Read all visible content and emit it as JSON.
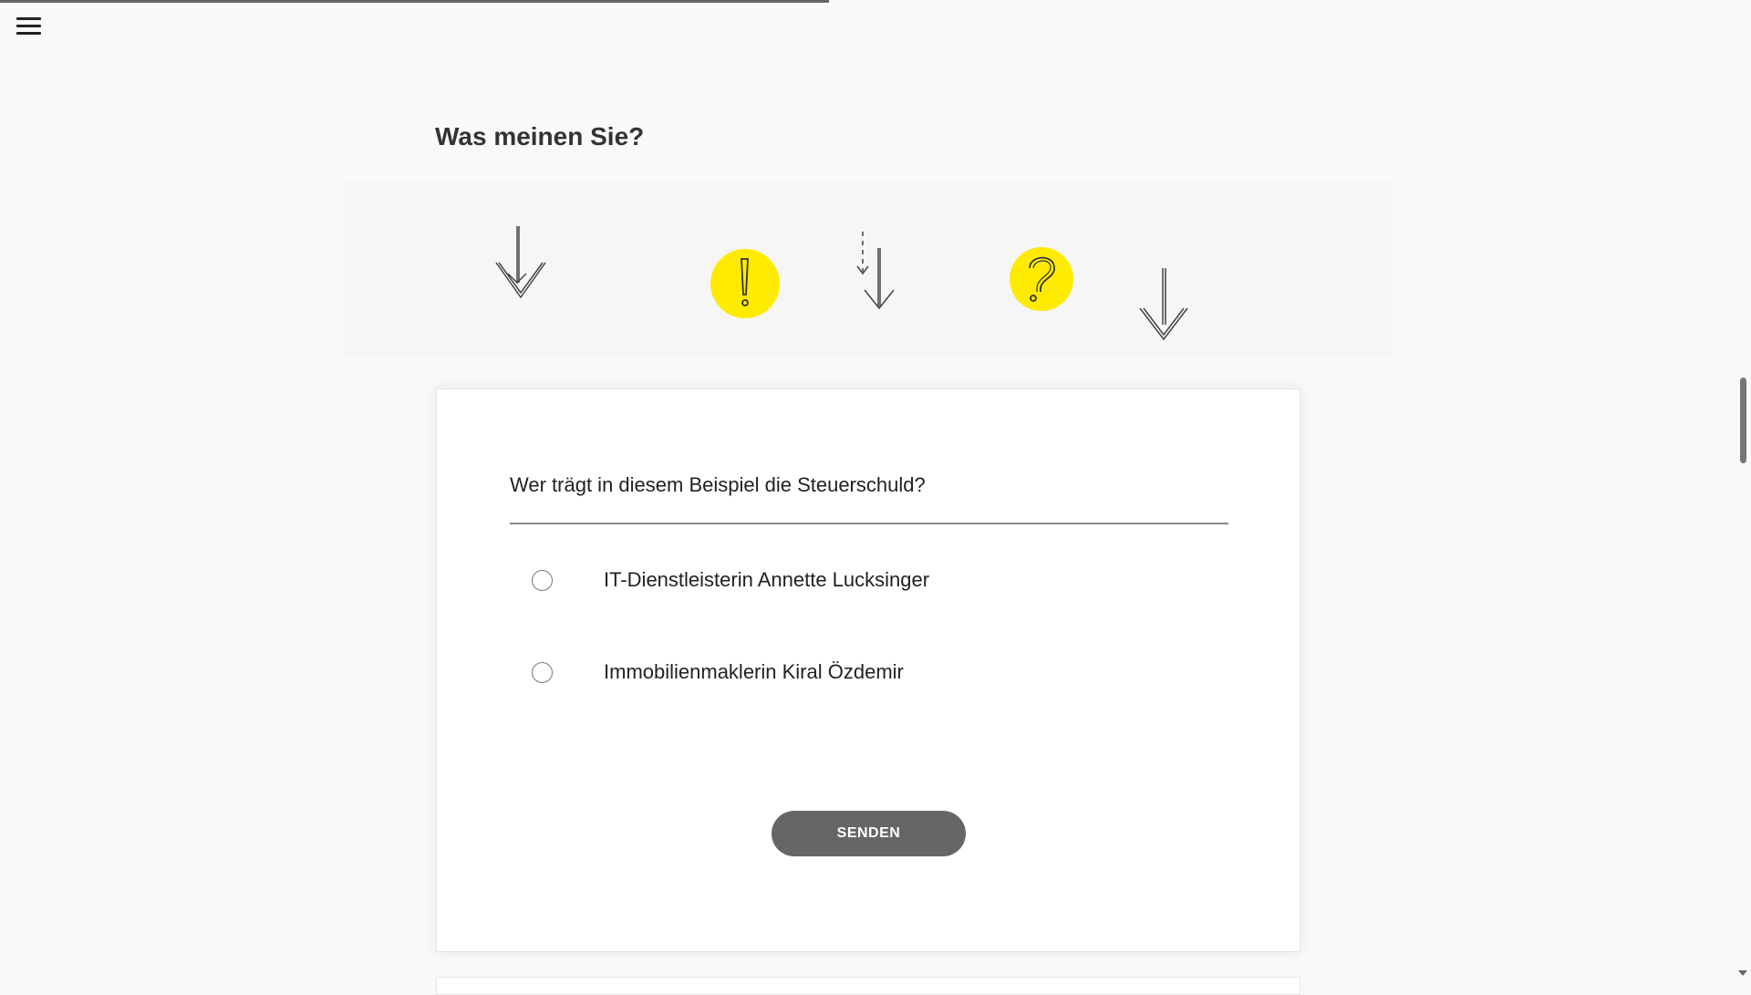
{
  "progress": {
    "fraction": 0.478
  },
  "menu": {
    "icon": "hamburger-menu-icon"
  },
  "page": {
    "heading": "Was meinen Sie?"
  },
  "illustration": {
    "icons": [
      "arrow-down-icon",
      "exclamation-circle-icon",
      "dashed-arrow-down-icon",
      "question-circle-icon",
      "arrow-down-icon"
    ],
    "accent_color": "#ffeb00"
  },
  "quiz": {
    "question": "Wer trägt in diesem Beispiel die Steuerschuld?",
    "options": [
      {
        "label": "IT-Dienstleisterin Annette Lucksinger",
        "selected": false
      },
      {
        "label": "Immobilienmaklerin Kiral Özdemir",
        "selected": false
      }
    ],
    "submit_label": "SENDEN",
    "submit_color": "#666666"
  }
}
